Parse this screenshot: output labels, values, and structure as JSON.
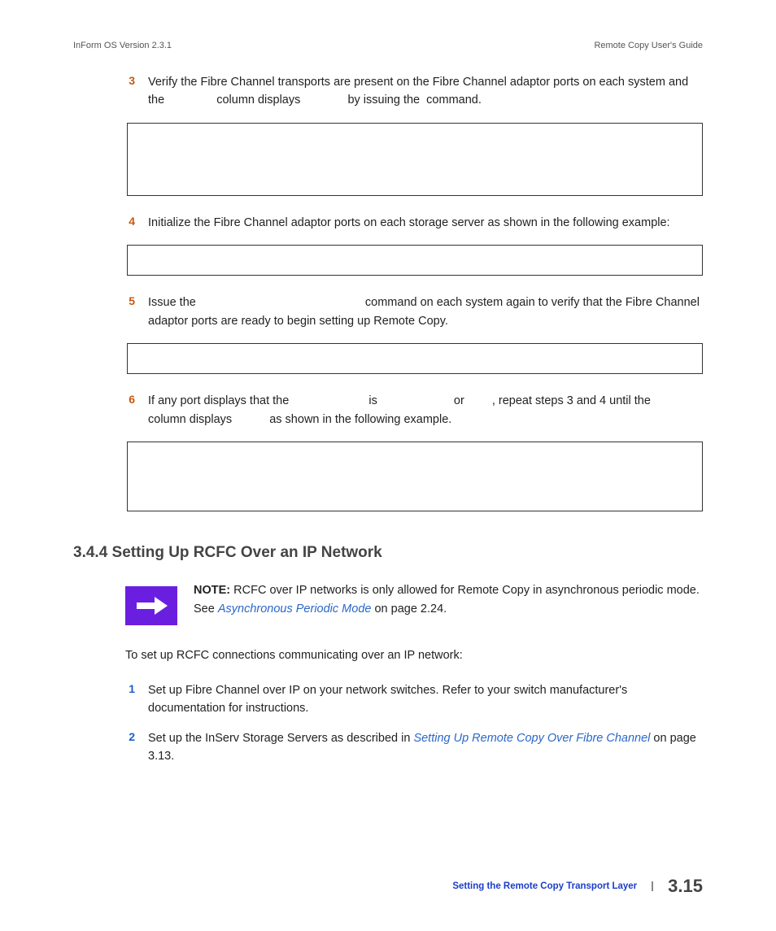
{
  "header": {
    "left": "InForm OS Version 2.3.1",
    "right": "Remote Copy User's Guide"
  },
  "steps": {
    "s3": {
      "num": "3",
      "text_a": "Verify the Fibre Channel transports are present on the Fibre Channel adaptor ports on each system and the ",
      "text_b": " column displays ",
      "text_c": " by issuing the ",
      "text_d": " command."
    },
    "s4": {
      "num": "4",
      "text": "Initialize the Fibre Channel adaptor ports on each storage server as shown in the following example:"
    },
    "s5": {
      "num": "5",
      "text_a": "Issue the ",
      "text_b": " command on each system again to verify that the Fibre Channel adaptor ports are ready to begin setting up Remote Copy."
    },
    "s6": {
      "num": "6",
      "text_a": "If any port displays that the ",
      "text_b": " is ",
      "text_c": " or ",
      "text_d": ", repeat steps 3 and 4 until the ",
      "text_e": " column displays ",
      "text_f": " as shown in the following example."
    }
  },
  "heading": "3.4.4 Setting Up RCFC Over an IP Network",
  "note": {
    "label": "NOTE:",
    "text_a": " RCFC over IP networks is only allowed for Remote Copy in asynchronous periodic mode. See ",
    "link": "Asynchronous Periodic Mode",
    "text_b": " on page 2.24."
  },
  "intro": "To set up RCFC connections communicating over an IP network:",
  "bsteps": {
    "b1": {
      "num": "1",
      "text": "Set up Fibre Channel over IP on your network switches. Refer to your switch manufacturer's documentation for instructions."
    },
    "b2": {
      "num": "2",
      "text_a": "Set up the InServ Storage Servers as described in ",
      "link": "Setting Up Remote Copy Over Fibre Channel",
      "text_b": " on page 3.13."
    }
  },
  "footer": {
    "section": "Setting the Remote Copy Transport Layer",
    "pagenum": "3.15"
  }
}
